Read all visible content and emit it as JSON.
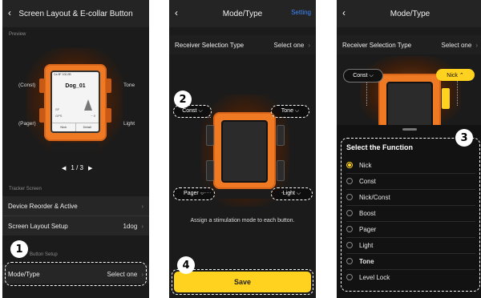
{
  "screen1": {
    "nav": {
      "back": "‹",
      "title": "Screen Layout & E-collar Button"
    },
    "preview_label": "Preview",
    "device": {
      "status": "Ca 5F  100,0B",
      "name": "Dog_01",
      "sf": "SF",
      "gps": "GPS",
      "left_soft": "Nick",
      "right_soft": "Detail",
      "dist": "~ 0"
    },
    "labels": {
      "const": "(Const)",
      "pager": "(Pager)",
      "tone": "Tone",
      "light": "Light"
    },
    "pager": {
      "prev": "◀",
      "text": "1 / 3",
      "next": "▶"
    },
    "tracker_label": "Tracker Screen",
    "rows": [
      {
        "label": "Device Reorder & Active",
        "value": ""
      },
      {
        "label": "Screen Layout Setup",
        "value": "1dog"
      }
    ],
    "button_setup_label": "Button Setup",
    "mode_row": {
      "label": "Mode/Type",
      "value": "Select one"
    },
    "badge": "1"
  },
  "screen2": {
    "nav": {
      "back": "‹",
      "title": "Mode/Type",
      "setting": "Setting"
    },
    "receiver_row": {
      "label": "Receiver Selection Type",
      "value": "Select one"
    },
    "buttons": {
      "const": "Const ⌵",
      "tone": "Tone ⌵",
      "pager": "Pager ⌵",
      "light": "Light ⌵"
    },
    "hint": "Assign a stimulation mode to each button.",
    "save": "Save",
    "badge_top": "2",
    "badge_bottom": "4"
  },
  "screen3": {
    "nav": {
      "back": "‹",
      "title": "Mode/Type"
    },
    "receiver_row": {
      "label": "Receiver Selection Type",
      "value": "Select one"
    },
    "buttons": {
      "const": "Const ⌵",
      "nick": "Nick ⌃"
    },
    "sheet_title": "Select the Function",
    "badge": "3",
    "functions": [
      "Nick",
      "Const",
      "Nick/Const",
      "Boost",
      "Pager",
      "Light",
      "Tone",
      "Level Lock"
    ],
    "selected": "Nick",
    "accent": "#ffd21f"
  }
}
